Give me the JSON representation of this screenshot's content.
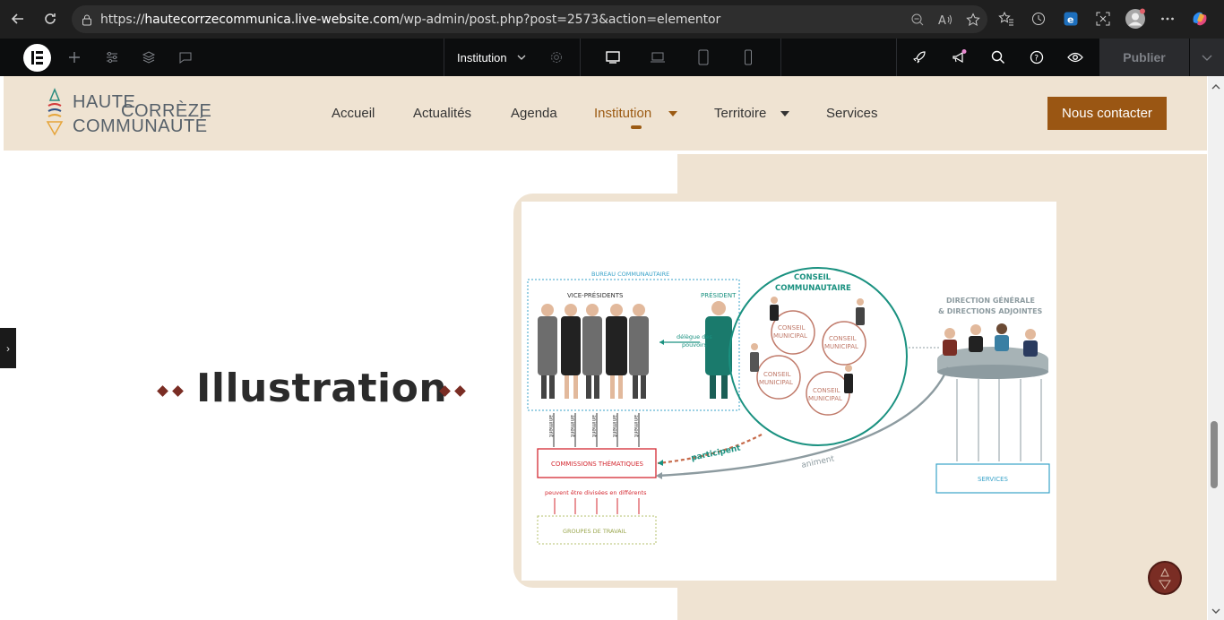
{
  "browser": {
    "url_prefix": "https://",
    "url_host": "hautecorrzecommunica.live-website.com",
    "url_path": "/wp-admin/post.php?post=2573&action=elementor"
  },
  "editor": {
    "page_name": "Institution",
    "publish_label": "Publier"
  },
  "site": {
    "logo_line1": "HAUTE",
    "logo_line1b": "CORRÈZE",
    "logo_line2": "COMMUNAUTÉ",
    "menu": [
      {
        "label": "Accueil"
      },
      {
        "label": "Actualités"
      },
      {
        "label": "Agenda"
      },
      {
        "label": "Institution"
      },
      {
        "label": "Territoire"
      },
      {
        "label": "Services"
      }
    ],
    "cta_label": "Nous contacter"
  },
  "content": {
    "heading": "Illustration"
  },
  "diagram": {
    "bureau": "BUREAU COMMUNAUTAIRE",
    "vice_presidents": "VICE-PRÉSIDENTS",
    "president": "PRÉSIDENT",
    "delegue": "délègue des",
    "pouvoirs": "pouvoirs",
    "conseil1": "CONSEIL",
    "conseil2": "COMMUNAUTAIRE",
    "cm1": "CONSEIL",
    "cm2": "MUNICIPAL",
    "direction1": "DIRECTION GÉNÉRALE",
    "direction2": "& DIRECTIONS ADJOINTES",
    "animent": "animent",
    "commissions": "COMMISSIONS THÉMATIQUES",
    "divisees": "peuvent être divisées en différents",
    "groupes": "GROUPES DE TRAVAIL",
    "participent": "participent",
    "anime": "animent",
    "services": "SERVICES"
  },
  "colors": {
    "accent": "#9a5613",
    "beige": "#efe3d2",
    "teal": "#1a9180",
    "red": "#d42a32",
    "blue": "#3aa3c9"
  }
}
